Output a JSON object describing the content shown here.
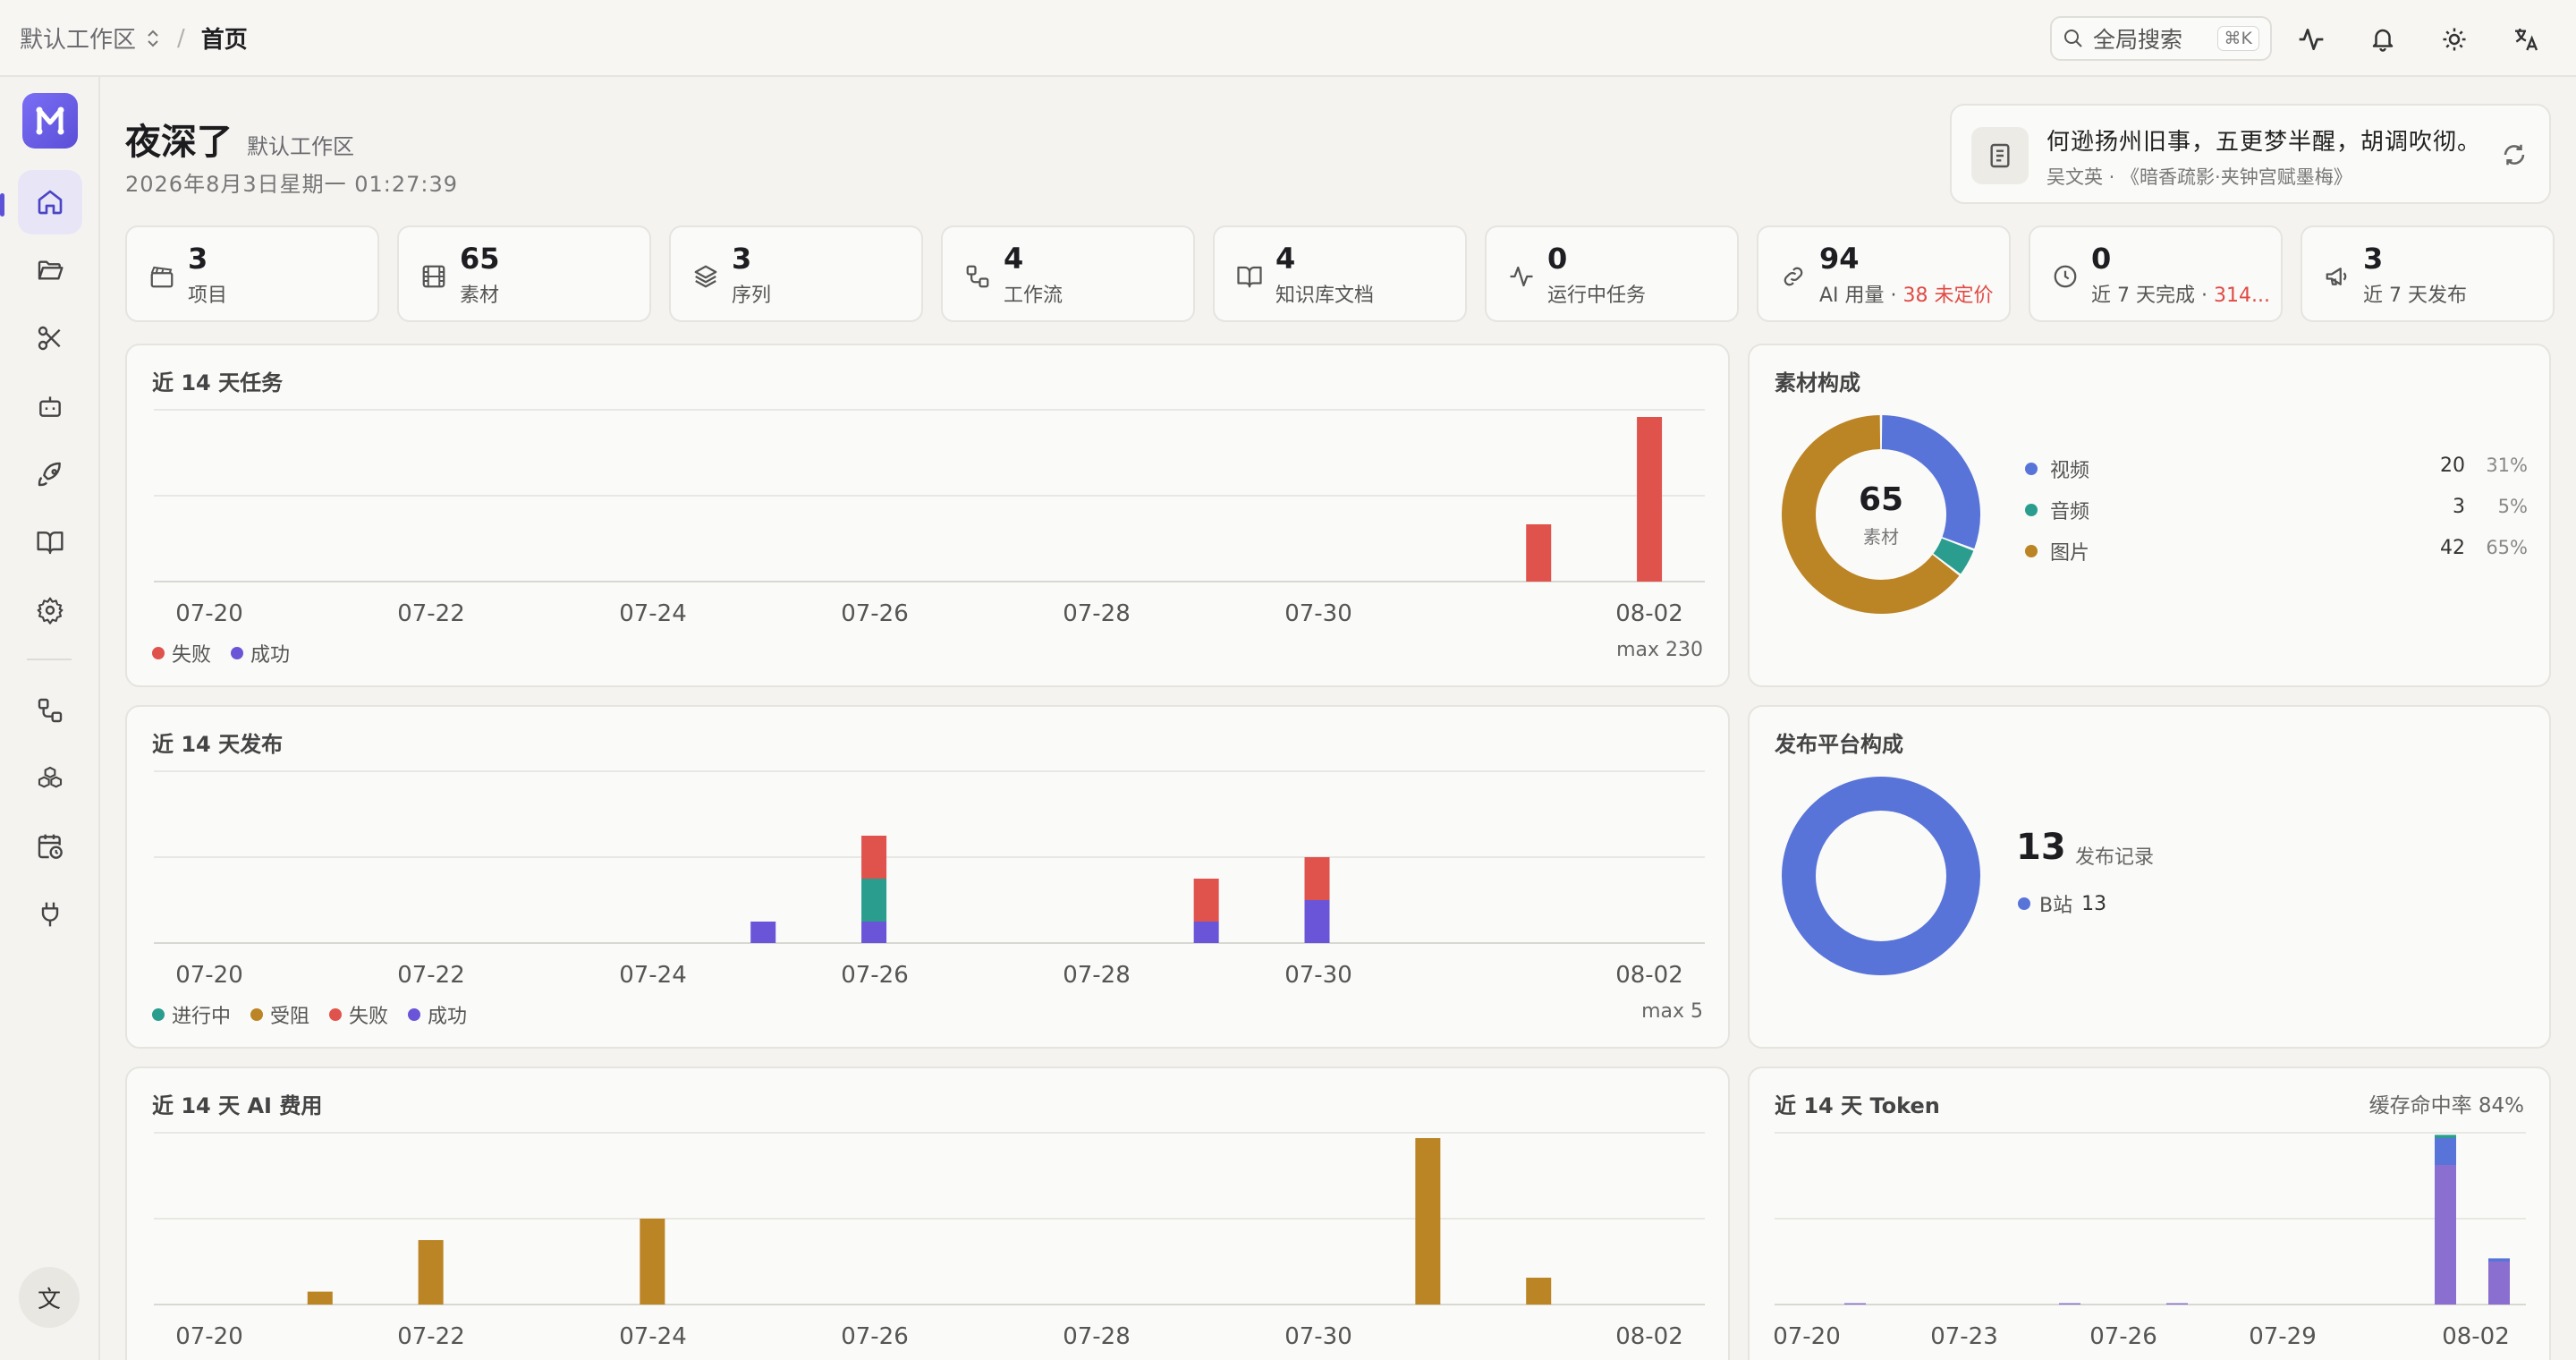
{
  "header": {
    "workspace": "默认工作区",
    "page": "首页",
    "search_label": "全局搜索",
    "search_kbd": "⌘K"
  },
  "greeting": {
    "title": "夜深了",
    "workspace": "默认工作区",
    "datetime": "2026年8月3日星期一 01:27:39"
  },
  "poem": {
    "line": "何逊扬州旧事，五更梦半醒，胡调吹彻。",
    "source": "吴文英 · 《暗香疏影·夹钟宫赋墨梅》"
  },
  "stats": [
    {
      "value": "3",
      "label": "项目",
      "icon": "clapperboard-icon"
    },
    {
      "value": "65",
      "label": "素材",
      "icon": "film-icon"
    },
    {
      "value": "3",
      "label": "序列",
      "icon": "layers-icon"
    },
    {
      "value": "4",
      "label": "工作流",
      "icon": "workflow-icon"
    },
    {
      "value": "4",
      "label": "知识库文档",
      "icon": "book-icon"
    },
    {
      "value": "0",
      "label": "运行中任务",
      "icon": "activity-icon"
    },
    {
      "value": "94",
      "label": "AI 用量 · ",
      "label_red": "38 未定价",
      "icon": "link-icon"
    },
    {
      "value": "0",
      "label": "近 7 天完成 · ",
      "label_red": "314...",
      "icon": "clock-icon"
    },
    {
      "value": "3",
      "label": "近 7 天发布",
      "icon": "megaphone-icon"
    }
  ],
  "colors": {
    "fail": "#e0534d",
    "success": "#6a55d8",
    "running": "#2a9d8f",
    "blocked": "#bb8424",
    "video": "#5874d8",
    "audio": "#2a9d8f",
    "image": "#bb8424",
    "token_a": "#8a6fd0",
    "token_b": "#5874d8",
    "token_c": "#2a9d8f"
  },
  "tasks": {
    "title": "近 14 天任务",
    "max_label": "max 230",
    "legend": [
      "失败",
      "成功"
    ]
  },
  "publish": {
    "title": "近 14 天发布",
    "max_label": "max 5",
    "legend": [
      "进行中",
      "受阻",
      "失败",
      "成功"
    ]
  },
  "ai_cost": {
    "title": "近 14 天 AI 费用"
  },
  "tokens": {
    "title": "近 14 天 Token",
    "cache_label": "缓存命中率 84%"
  },
  "assets": {
    "title": "素材构成",
    "total": "65",
    "total_label": "素材",
    "items": [
      {
        "name": "视频",
        "count": "20",
        "pct": "31%"
      },
      {
        "name": "音频",
        "count": "3",
        "pct": "5%"
      },
      {
        "name": "图片",
        "count": "42",
        "pct": "65%"
      }
    ]
  },
  "platforms": {
    "title": "发布平台构成",
    "total": "13",
    "total_label": "发布记录",
    "items": [
      {
        "name": "B站",
        "count": "13"
      }
    ]
  },
  "chart_data": [
    {
      "type": "bar",
      "title": "近 14 天任务",
      "categories": [
        "07-20",
        "07-21",
        "07-22",
        "07-23",
        "07-24",
        "07-25",
        "07-26",
        "07-27",
        "07-28",
        "07-29",
        "07-30",
        "07-31",
        "08-01",
        "08-02"
      ],
      "tick_labels": [
        "07-20",
        "07-22",
        "07-24",
        "07-26",
        "07-28",
        "07-30",
        "08-02"
      ],
      "series": [
        {
          "name": "失败",
          "values": [
            0,
            0,
            0,
            0,
            0,
            0,
            0,
            0,
            0,
            0,
            0,
            0,
            80,
            230
          ]
        },
        {
          "name": "成功",
          "values": [
            0,
            0,
            0,
            0,
            0,
            0,
            0,
            0,
            0,
            0,
            0,
            0,
            0,
            0
          ]
        }
      ],
      "ylim": [
        0,
        240
      ]
    },
    {
      "type": "bar",
      "title": "近 14 天发布",
      "categories": [
        "07-20",
        "07-21",
        "07-22",
        "07-23",
        "07-24",
        "07-25",
        "07-26",
        "07-27",
        "07-28",
        "07-29",
        "07-30",
        "07-31",
        "08-01",
        "08-02"
      ],
      "tick_labels": [
        "07-20",
        "07-22",
        "07-24",
        "07-26",
        "07-28",
        "07-30",
        "08-02"
      ],
      "series": [
        {
          "name": "成功",
          "values": [
            0,
            0,
            0,
            0,
            0,
            1,
            1,
            0,
            0,
            1,
            2,
            0,
            0,
            0
          ]
        },
        {
          "name": "进行中",
          "values": [
            0,
            0,
            0,
            0,
            0,
            0,
            2,
            0,
            0,
            0,
            0,
            0,
            0,
            0
          ]
        },
        {
          "name": "失败",
          "values": [
            0,
            0,
            0,
            0,
            0,
            0,
            2,
            0,
            0,
            2,
            2,
            0,
            0,
            0
          ]
        },
        {
          "name": "受阻",
          "values": [
            0,
            0,
            0,
            0,
            0,
            0,
            0,
            0,
            0,
            0,
            0,
            0,
            0,
            0
          ]
        }
      ],
      "ylim": [
        0,
        8
      ]
    },
    {
      "type": "bar",
      "title": "近 14 天 AI 费用",
      "categories": [
        "07-20",
        "07-21",
        "07-22",
        "07-23",
        "07-24",
        "07-25",
        "07-26",
        "07-27",
        "07-28",
        "07-29",
        "07-30",
        "07-31",
        "08-01",
        "08-02"
      ],
      "tick_labels": [
        "07-20",
        "07-22",
        "07-24",
        "07-26",
        "07-28",
        "07-30",
        "08-02"
      ],
      "series": [
        {
          "values": [
            0,
            0.12,
            0.6,
            0,
            0.8,
            0,
            0,
            0,
            0,
            0,
            0,
            1.55,
            0.25,
            0
          ]
        }
      ],
      "ylim": [
        0,
        1.6
      ]
    },
    {
      "type": "bar",
      "title": "近 14 天 Token",
      "categories": [
        "07-20",
        "07-21",
        "07-22",
        "07-23",
        "07-24",
        "07-25",
        "07-26",
        "07-27",
        "07-28",
        "07-29",
        "07-30",
        "07-31",
        "08-01",
        "08-02"
      ],
      "tick_labels": [
        "07-20",
        "07-23",
        "07-26",
        "07-29",
        "08-02"
      ],
      "series": [
        {
          "values": [
            0,
            0.005,
            0,
            0,
            0,
            0.005,
            0,
            0.005,
            0,
            0,
            0,
            0,
            1.3,
            0.4
          ]
        },
        {
          "values": [
            0,
            0,
            0,
            0,
            0,
            0,
            0,
            0,
            0,
            0,
            0,
            0,
            0.25,
            0.03
          ]
        },
        {
          "values": [
            0,
            0,
            0,
            0,
            0,
            0,
            0,
            0,
            0,
            0,
            0,
            0,
            0.03,
            0
          ]
        }
      ],
      "ylim": [
        0,
        1.6
      ]
    },
    {
      "type": "pie",
      "title": "素材构成",
      "categories": [
        "视频",
        "音频",
        "图片"
      ],
      "values": [
        20,
        3,
        42
      ]
    },
    {
      "type": "pie",
      "title": "发布平台构成",
      "categories": [
        "B站"
      ],
      "values": [
        13
      ]
    }
  ]
}
